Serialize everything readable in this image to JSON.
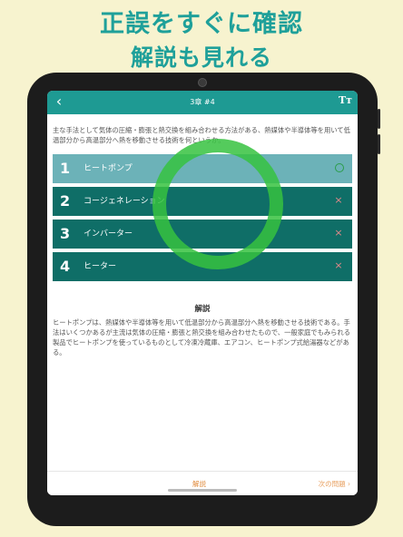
{
  "promo": {
    "line1": "正誤をすぐに確認",
    "line2": "解説も見れる"
  },
  "navbar": {
    "back_icon": "‹",
    "title": "3章 #4",
    "text_size_icon": "Tт"
  },
  "question": {
    "text": "主な手法として気体の圧縮・膨張と熱交換を組み合わせる方法がある、熱媒体や半導体等を用いて低温部分から高温部分へ熱を移動させる技術を何というか。"
  },
  "options": [
    {
      "number": "1",
      "label": "ヒートポンプ",
      "result": "correct"
    },
    {
      "number": "2",
      "label": "コージェネレーション",
      "result": "wrong",
      "mark": "×"
    },
    {
      "number": "3",
      "label": "インバーター",
      "result": "wrong",
      "mark": "×"
    },
    {
      "number": "4",
      "label": "ヒーター",
      "result": "wrong",
      "mark": "×"
    }
  ],
  "explanation": {
    "title": "解説",
    "body": "ヒートポンプは、熱媒体や半導体等を用いて低温部分から高温部分へ熱を移動させる技術である。手法はいくつかあるが主流は気体の圧縮・膨張と熱交換を組み合わせたもので、一般家庭でもみられる製品でヒートポンプを使っているものとして冷凍冷蔵庫、エアコン、ヒートポンプ式給湯器などがある。"
  },
  "bottom": {
    "tab_label": "解説",
    "next_label": "次の問題 ›"
  },
  "colors": {
    "background": "#f7f3cf",
    "accent": "#1e9a93",
    "option_bg": "#0f6e67",
    "option_selected_bg": "#6cb2b8",
    "correct_circle": "#36c240",
    "wrong_mark": "#e0888a"
  }
}
